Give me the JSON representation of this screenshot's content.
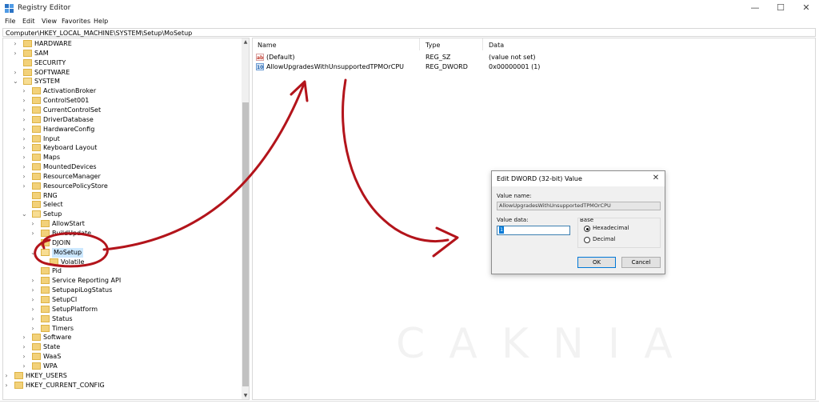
{
  "window": {
    "title": "Registry Editor",
    "minimize": "—",
    "maximize": "☐",
    "close": "✕"
  },
  "menu": [
    "File",
    "Edit",
    "View",
    "Favorites",
    "Help"
  ],
  "address": "Computer\\HKEY_LOCAL_MACHINE\\SYSTEM\\Setup\\MoSetup",
  "tree": [
    {
      "label": "HARDWARE",
      "chev": ">"
    },
    {
      "label": "SAM",
      "chev": ">"
    },
    {
      "label": "SECURITY",
      "chev": ""
    },
    {
      "label": "SOFTWARE",
      "chev": ">"
    },
    {
      "label": "SYSTEM",
      "chev": "v"
    },
    {
      "label": "ActivationBroker",
      "chev": ">"
    },
    {
      "label": "ControlSet001",
      "chev": ">"
    },
    {
      "label": "CurrentControlSet",
      "chev": ">"
    },
    {
      "label": "DriverDatabase",
      "chev": ">"
    },
    {
      "label": "HardwareConfig",
      "chev": ">"
    },
    {
      "label": "Input",
      "chev": ">"
    },
    {
      "label": "Keyboard Layout",
      "chev": ">"
    },
    {
      "label": "Maps",
      "chev": ">"
    },
    {
      "label": "MountedDevices",
      "chev": ">"
    },
    {
      "label": "ResourceManager",
      "chev": ">"
    },
    {
      "label": "ResourcePolicyStore",
      "chev": ">"
    },
    {
      "label": "RNG",
      "chev": ""
    },
    {
      "label": "Select",
      "chev": ""
    },
    {
      "label": "Setup",
      "chev": "v"
    },
    {
      "label": "AllowStart",
      "chev": ">"
    },
    {
      "label": "BuildUpdate",
      "chev": ">"
    },
    {
      "label": "DJOIN",
      "chev": ""
    },
    {
      "label": "MoSetup",
      "chev": "v"
    },
    {
      "label": "Volatile",
      "chev": ""
    },
    {
      "label": "Pid",
      "chev": ""
    },
    {
      "label": "Service Reporting API",
      "chev": ">"
    },
    {
      "label": "SetupapiLogStatus",
      "chev": ">"
    },
    {
      "label": "SetupCI",
      "chev": ">"
    },
    {
      "label": "SetupPlatform",
      "chev": ">"
    },
    {
      "label": "Status",
      "chev": ">"
    },
    {
      "label": "Timers",
      "chev": ">"
    },
    {
      "label": "Software",
      "chev": ">"
    },
    {
      "label": "State",
      "chev": ">"
    },
    {
      "label": "WaaS",
      "chev": ">"
    },
    {
      "label": "WPA",
      "chev": ">"
    },
    {
      "label": "HKEY_USERS",
      "chev": ">"
    },
    {
      "label": "HKEY_CURRENT_CONFIG",
      "chev": ">"
    }
  ],
  "columns": {
    "name": "Name",
    "type": "Type",
    "data": "Data"
  },
  "values": [
    {
      "name": "(Default)",
      "type": "REG_SZ",
      "data": "(value not set)",
      "icon": "ab"
    },
    {
      "name": "AllowUpgradesWithUnsupportedTPMOrCPU",
      "type": "REG_DWORD",
      "data": "0x00000001 (1)",
      "icon": "10"
    }
  ],
  "dialog": {
    "title": "Edit DWORD (32-bit) Value",
    "close": "✕",
    "value_name_label": "Value name:",
    "value_name": "AllowUpgradesWithUnsupportedTPMOrCPU",
    "value_data_label": "Value data:",
    "value_data": "1",
    "base_label": "Base",
    "hex_label": "Hexadecimal",
    "dec_label": "Decimal",
    "ok": "OK",
    "cancel": "Cancel"
  },
  "watermark": "CAKNIA",
  "colors": {
    "annotation": "#b3141b",
    "selection": "#cce8ff",
    "accent": "#0078d7"
  }
}
